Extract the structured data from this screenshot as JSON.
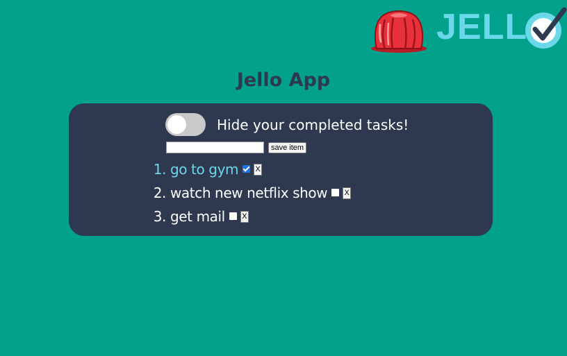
{
  "logo": {
    "text": "JELL",
    "icon": "jello-icon",
    "check_icon": "check-o-icon"
  },
  "page": {
    "title": "Jello App"
  },
  "controls": {
    "toggle_on": false,
    "toggle_label": "Hide your completed tasks!",
    "input_value": "",
    "input_placeholder": "",
    "save_label": "save item"
  },
  "tasks": [
    {
      "num": "1.",
      "text": "go to gym",
      "completed": true,
      "delete_label": "X"
    },
    {
      "num": "2.",
      "text": "watch new netflix show",
      "completed": false,
      "delete_label": "X"
    },
    {
      "num": "3.",
      "text": "get mail",
      "completed": false,
      "delete_label": "X"
    }
  ],
  "colors": {
    "background": "#02a18b",
    "panel": "#2e384f",
    "title": "#2d3a4e",
    "accent": "#6ad8e8",
    "jello_red": "#e8313a"
  }
}
